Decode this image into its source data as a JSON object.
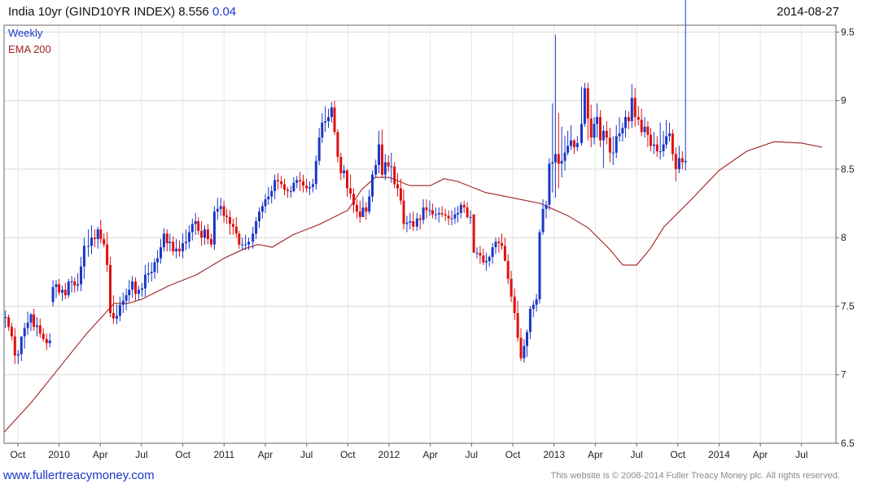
{
  "header": {
    "title": "India 10yr (GIND10YR INDEX) 8.556",
    "change": "0.04",
    "date": "2014-08-27"
  },
  "footer": {
    "site": "www.fullertreacymoney.com",
    "copyright": "This website is © 2008-2014 Fuller Treacy Money plc. All rights reserved."
  },
  "colors": {
    "up": "#1a37c8",
    "down": "#e01010",
    "ema": "#a02020",
    "grid": "#d8d8d8"
  },
  "chart_data": {
    "type": "candlestick",
    "legend": [
      "Weekly",
      "EMA 200"
    ],
    "legend_colors": [
      "#1a37c8",
      "#a02020"
    ],
    "y_ticks": [
      6.5,
      7,
      7.5,
      8,
      8.5,
      9,
      9.5
    ],
    "y_tick_labels": [
      "6.5",
      "7",
      "7.5",
      "8",
      "8.5",
      "9",
      "9.5"
    ],
    "ylim": [
      6.5,
      9.55
    ],
    "x_tick_labels": [
      "Oct",
      "2010",
      "Apr",
      "Jul",
      "Oct",
      "2011",
      "Apr",
      "Jul",
      "Oct",
      "2012",
      "Apr",
      "Jul",
      "Oct",
      "2013",
      "Apr",
      "Jul",
      "Oct",
      "2014",
      "Apr",
      "Jul"
    ],
    "x_tick_months": [
      1,
      4,
      7,
      10,
      13,
      16,
      19,
      22,
      25,
      28,
      31,
      34,
      37,
      40,
      43,
      46,
      49,
      52,
      55,
      58
    ],
    "x_range_months": [
      0,
      60.5
    ],
    "month_origin": "2009-09",
    "ohlc_series": {
      "name": "Weekly",
      "start_date": "2009-09-04",
      "interval_days": 7,
      "open": [
        7.42,
        7.42,
        7.35,
        7.28,
        7.14,
        7.15,
        7.28,
        7.34,
        7.38,
        7.44,
        7.35,
        7.36,
        7.3,
        7.26,
        7.23,
        7.53,
        7.64,
        7.66,
        7.6,
        7.62,
        7.58,
        7.68,
        7.68,
        7.65,
        7.66,
        7.79,
        7.94,
        7.94,
        8.0,
        7.99,
        8.06,
        7.99,
        7.95,
        7.8,
        7.45,
        7.41,
        7.43,
        7.51,
        7.54,
        7.58,
        7.62,
        7.68,
        7.59,
        7.62,
        7.63,
        7.73,
        7.74,
        7.75,
        7.82,
        7.85,
        7.93,
        8.03,
        7.96,
        7.97,
        7.9,
        7.92,
        7.9,
        7.96,
        7.97,
        8.04,
        8.1,
        8.12,
        8.05,
        8.0,
        8.06,
        7.99,
        7.95,
        8.19,
        8.21,
        8.23,
        8.16,
        8.15,
        8.1,
        8.08,
        8.03,
        7.95,
        7.95,
        7.95,
        7.97,
        8.03,
        8.12,
        8.19,
        8.23,
        8.28,
        8.3,
        8.34,
        8.42,
        8.41,
        8.39,
        8.35,
        8.34,
        8.34,
        8.4,
        8.42,
        8.41,
        8.38,
        8.36,
        8.37,
        8.39,
        8.56,
        8.73,
        8.84,
        8.85,
        8.88,
        8.95,
        8.77,
        8.59,
        8.47,
        8.49,
        8.36,
        8.32,
        8.24,
        8.19,
        8.15,
        8.22,
        8.19,
        8.3,
        8.46,
        8.53,
        8.68,
        8.46,
        8.55,
        8.52,
        8.52,
        8.39,
        8.36,
        8.27,
        8.1,
        8.11,
        8.12,
        8.08,
        8.14,
        8.13,
        8.22,
        8.2,
        8.2,
        8.17,
        8.17,
        8.18,
        8.17,
        8.16,
        8.14,
        8.14,
        8.17,
        8.18,
        8.24,
        8.22,
        8.15,
        8.17,
        7.89,
        7.89,
        7.87,
        7.82,
        7.83,
        7.86,
        7.93,
        7.97,
        7.96,
        7.94,
        7.83,
        7.7,
        7.57,
        7.45,
        7.27,
        7.12,
        7.21,
        7.31,
        7.48,
        7.51,
        7.55,
        8.04,
        8.21,
        8.24,
        8.54,
        8.55,
        8.61,
        8.54,
        8.56,
        8.62,
        8.67,
        8.71,
        8.66,
        8.69,
        8.83,
        9.09,
        8.87,
        8.73,
        8.83,
        8.88,
        8.71,
        8.78,
        8.73,
        8.62,
        8.62,
        8.74,
        8.76,
        8.8,
        8.88,
        8.85,
        9.02,
        8.88,
        8.86,
        8.77,
        8.81,
        8.75,
        8.67,
        8.68,
        8.63,
        8.63,
        8.68,
        8.74,
        8.76,
        8.61,
        8.5,
        8.58,
        8.55
      ],
      "high": [
        7.47,
        7.44,
        7.38,
        7.34,
        7.18,
        7.23,
        7.38,
        7.46,
        7.45,
        7.48,
        7.42,
        7.41,
        7.34,
        7.3,
        7.3,
        7.69,
        7.69,
        7.7,
        7.65,
        7.67,
        7.7,
        7.72,
        7.71,
        7.74,
        7.86,
        8.0,
        8.06,
        8.09,
        8.06,
        8.08,
        8.13,
        8.03,
        8.04,
        7.86,
        7.58,
        7.51,
        7.57,
        7.6,
        7.63,
        7.69,
        7.72,
        7.71,
        7.65,
        7.67,
        7.8,
        7.82,
        7.82,
        7.85,
        7.91,
        7.99,
        8.07,
        8.06,
        8.03,
        8.01,
        7.99,
        7.98,
        8.03,
        8.06,
        8.09,
        8.14,
        8.18,
        8.15,
        8.12,
        8.09,
        8.1,
        8.03,
        8.23,
        8.29,
        8.29,
        8.27,
        8.21,
        8.2,
        8.14,
        8.15,
        8.05,
        8.0,
        8.02,
        8.0,
        8.08,
        8.15,
        8.22,
        8.26,
        8.32,
        8.37,
        8.38,
        8.46,
        8.47,
        8.45,
        8.43,
        8.37,
        8.38,
        8.44,
        8.45,
        8.48,
        8.46,
        8.43,
        8.41,
        8.43,
        8.6,
        8.8,
        8.91,
        8.96,
        8.94,
        8.99,
        9.0,
        8.79,
        8.62,
        8.53,
        8.5,
        8.46,
        8.36,
        8.28,
        8.27,
        8.3,
        8.26,
        8.35,
        8.49,
        8.57,
        8.78,
        8.79,
        8.61,
        8.6,
        8.62,
        8.55,
        8.47,
        8.43,
        8.35,
        8.16,
        8.18,
        8.19,
        8.18,
        8.17,
        8.28,
        8.28,
        8.27,
        8.25,
        8.22,
        8.22,
        8.23,
        8.21,
        8.2,
        8.2,
        8.22,
        8.23,
        8.26,
        8.27,
        8.26,
        8.2,
        8.17,
        7.93,
        7.94,
        7.92,
        7.89,
        7.87,
        7.96,
        8.0,
        8.0,
        8.03,
        8.0,
        7.88,
        7.76,
        7.63,
        7.54,
        7.34,
        7.26,
        7.33,
        7.5,
        7.54,
        7.59,
        8.06,
        8.28,
        8.27,
        8.58,
        8.98,
        9.48,
        8.91,
        8.81,
        8.74,
        8.78,
        8.82,
        8.72,
        8.74,
        9.1,
        9.13,
        9.13,
        8.97,
        8.88,
        8.98,
        8.93,
        8.82,
        8.85,
        8.8,
        8.74,
        8.82,
        8.88,
        8.84,
        8.93,
        8.92,
        9.12,
        9.09,
        8.96,
        8.94,
        8.88,
        8.85,
        8.8,
        8.77,
        8.74,
        8.84,
        8.78,
        8.86,
        8.84,
        8.79,
        8.66,
        8.67,
        8.63
      ],
      "low": [
        7.34,
        7.32,
        7.25,
        7.08,
        7.08,
        7.1,
        7.19,
        7.29,
        7.32,
        7.32,
        7.28,
        7.27,
        7.24,
        7.18,
        7.2,
        7.5,
        7.56,
        7.58,
        7.54,
        7.55,
        7.56,
        7.6,
        7.6,
        7.61,
        7.61,
        7.7,
        7.86,
        7.88,
        7.93,
        7.92,
        7.96,
        7.93,
        7.75,
        7.42,
        7.37,
        7.37,
        7.39,
        7.45,
        7.47,
        7.53,
        7.56,
        7.54,
        7.54,
        7.57,
        7.57,
        7.67,
        7.68,
        7.7,
        7.74,
        7.81,
        7.9,
        7.9,
        7.9,
        7.87,
        7.85,
        7.86,
        7.85,
        7.91,
        7.92,
        7.98,
        8.02,
        8.02,
        7.94,
        7.95,
        7.95,
        7.93,
        7.91,
        8.13,
        8.16,
        8.11,
        8.1,
        8.02,
        8.02,
        8.0,
        7.92,
        7.91,
        7.91,
        7.91,
        7.92,
        7.99,
        8.07,
        8.14,
        8.18,
        8.24,
        8.25,
        8.28,
        8.35,
        8.36,
        8.31,
        8.29,
        8.29,
        8.33,
        8.36,
        8.34,
        8.33,
        8.33,
        8.31,
        8.33,
        8.35,
        8.53,
        8.69,
        8.77,
        8.8,
        8.84,
        8.75,
        8.55,
        8.42,
        8.43,
        8.3,
        8.28,
        8.18,
        8.14,
        8.11,
        8.15,
        8.13,
        8.17,
        8.26,
        8.44,
        8.47,
        8.44,
        8.42,
        8.48,
        8.4,
        8.36,
        8.3,
        8.24,
        8.06,
        8.04,
        8.06,
        8.05,
        8.05,
        8.06,
        8.1,
        8.14,
        8.16,
        8.14,
        8.13,
        8.11,
        8.15,
        8.12,
        8.09,
        8.09,
        8.1,
        8.11,
        8.14,
        8.18,
        8.14,
        8.1,
        8.1,
        7.85,
        7.81,
        7.8,
        7.76,
        7.79,
        7.81,
        7.88,
        7.89,
        7.91,
        7.83,
        7.66,
        7.53,
        7.4,
        7.24,
        7.1,
        7.09,
        7.13,
        7.26,
        7.42,
        7.46,
        7.52,
        8.02,
        8.14,
        8.2,
        8.33,
        8.29,
        8.36,
        8.44,
        8.49,
        8.6,
        8.64,
        8.61,
        8.63,
        8.67,
        8.81,
        8.71,
        8.66,
        8.68,
        8.73,
        8.66,
        8.51,
        8.68,
        8.55,
        8.53,
        8.58,
        8.7,
        8.7,
        8.73,
        8.79,
        8.8,
        8.81,
        8.82,
        8.74,
        8.73,
        8.66,
        8.63,
        8.61,
        8.59,
        8.57,
        8.59,
        8.65,
        8.7,
        8.56,
        8.41,
        8.47,
        8.5,
        8.49
      ],
      "close": [
        7.42,
        7.35,
        7.28,
        7.14,
        7.15,
        7.28,
        7.34,
        7.38,
        7.44,
        7.35,
        7.36,
        7.3,
        7.26,
        7.23,
        7.25,
        7.64,
        7.66,
        7.6,
        7.62,
        7.58,
        7.68,
        7.68,
        7.65,
        7.66,
        7.79,
        7.94,
        7.94,
        8.0,
        7.99,
        8.06,
        7.99,
        7.95,
        7.8,
        7.45,
        7.41,
        7.43,
        7.51,
        7.54,
        7.58,
        7.62,
        7.68,
        7.59,
        7.62,
        7.63,
        7.73,
        7.74,
        7.75,
        7.82,
        7.85,
        7.93,
        8.03,
        7.96,
        7.97,
        7.9,
        7.92,
        7.9,
        7.96,
        7.97,
        8.04,
        8.1,
        8.12,
        8.05,
        8.0,
        8.06,
        7.99,
        7.95,
        8.19,
        8.21,
        8.23,
        8.16,
        8.15,
        8.1,
        8.08,
        8.03,
        7.95,
        7.95,
        7.95,
        7.97,
        8.03,
        8.12,
        8.19,
        8.23,
        8.28,
        8.3,
        8.34,
        8.42,
        8.41,
        8.39,
        8.35,
        8.34,
        8.34,
        8.4,
        8.42,
        8.41,
        8.38,
        8.36,
        8.37,
        8.39,
        8.56,
        8.73,
        8.84,
        8.85,
        8.88,
        8.95,
        8.77,
        8.59,
        8.47,
        8.49,
        8.36,
        8.32,
        8.24,
        8.19,
        8.15,
        8.22,
        8.19,
        8.3,
        8.46,
        8.53,
        8.68,
        8.46,
        8.55,
        8.52,
        8.52,
        8.39,
        8.36,
        8.27,
        8.1,
        8.11,
        8.12,
        8.08,
        8.14,
        8.13,
        8.22,
        8.2,
        8.2,
        8.17,
        8.17,
        8.18,
        8.17,
        8.16,
        8.14,
        8.14,
        8.17,
        8.18,
        8.24,
        8.22,
        8.15,
        8.15,
        7.89,
        7.89,
        7.87,
        7.82,
        7.83,
        7.86,
        7.93,
        7.97,
        7.96,
        7.94,
        7.83,
        7.7,
        7.57,
        7.45,
        7.27,
        7.12,
        7.21,
        7.31,
        7.48,
        7.51,
        7.55,
        8.04,
        8.21,
        8.24,
        8.54,
        8.55,
        8.61,
        8.54,
        8.56,
        8.62,
        8.67,
        8.71,
        8.66,
        8.69,
        8.83,
        9.09,
        8.87,
        8.73,
        8.83,
        8.88,
        8.71,
        8.78,
        8.73,
        8.62,
        8.62,
        8.74,
        8.76,
        8.8,
        8.88,
        8.85,
        9.02,
        8.88,
        8.86,
        8.77,
        8.81,
        8.75,
        8.67,
        8.68,
        8.63,
        8.63,
        8.68,
        8.74,
        8.76,
        8.61,
        8.5,
        8.58,
        8.55,
        8.56
      ]
    },
    "ema_series": {
      "name": "EMA 200",
      "points": [
        [
          0.0,
          6.58
        ],
        [
          2.0,
          6.8
        ],
        [
          4.0,
          7.05
        ],
        [
          6.0,
          7.3
        ],
        [
          8.0,
          7.52
        ],
        [
          9.0,
          7.52
        ],
        [
          10.0,
          7.55
        ],
        [
          12.0,
          7.65
        ],
        [
          14.0,
          7.73
        ],
        [
          16.0,
          7.85
        ],
        [
          17.5,
          7.92
        ],
        [
          18.5,
          7.95
        ],
        [
          19.5,
          7.93
        ],
        [
          21.0,
          8.02
        ],
        [
          23.0,
          8.1
        ],
        [
          25.0,
          8.2
        ],
        [
          26.0,
          8.35
        ],
        [
          27.0,
          8.44
        ],
        [
          28.0,
          8.44
        ],
        [
          29.5,
          8.38
        ],
        [
          31.0,
          8.38
        ],
        [
          32.0,
          8.43
        ],
        [
          33.0,
          8.41
        ],
        [
          35.0,
          8.33
        ],
        [
          37.0,
          8.29
        ],
        [
          39.0,
          8.25
        ],
        [
          41.0,
          8.16
        ],
        [
          42.5,
          8.07
        ],
        [
          44.0,
          7.92
        ],
        [
          45.0,
          7.8
        ],
        [
          46.0,
          7.8
        ],
        [
          47.0,
          7.92
        ],
        [
          48.0,
          8.08
        ],
        [
          50.0,
          8.28
        ],
        [
          52.0,
          8.49
        ],
        [
          54.0,
          8.63
        ],
        [
          56.0,
          8.7
        ],
        [
          58.0,
          8.69
        ],
        [
          59.5,
          8.66
        ]
      ]
    }
  }
}
